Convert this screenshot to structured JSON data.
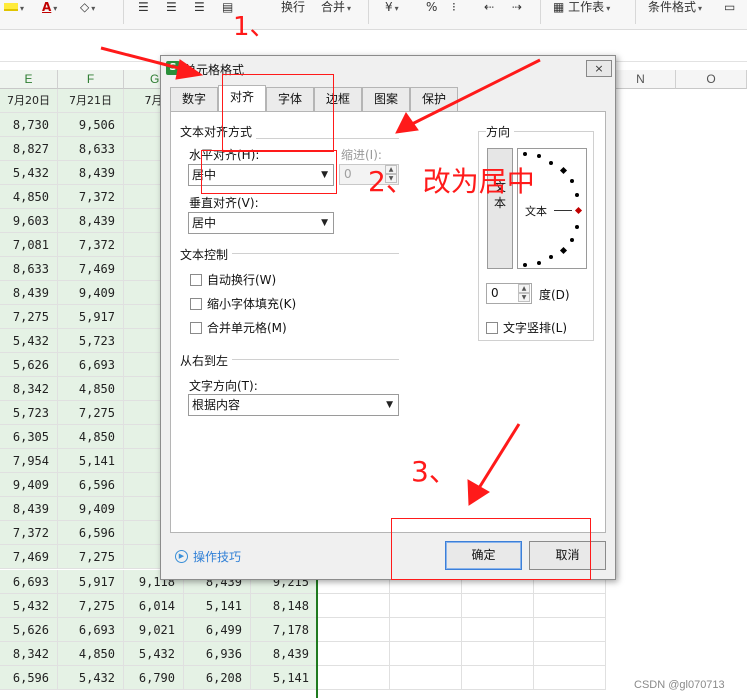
{
  "ribbon": {
    "items": [
      "换行",
      "合并",
      "%",
      "工作表",
      "条件格式"
    ]
  },
  "sheet": {
    "columns": [
      "E",
      "F",
      "G",
      "N",
      "O"
    ],
    "header_row": [
      "7月20日",
      "7月21日",
      "7月"
    ],
    "rows": [
      [
        "8,730",
        "9,506",
        "8,"
      ],
      [
        "8,827",
        "8,633",
        "5,"
      ],
      [
        "5,432",
        "8,439",
        "6,"
      ],
      [
        "4,850",
        "7,372",
        "6,"
      ],
      [
        "9,603",
        "8,439",
        "9,"
      ],
      [
        "7,081",
        "7,372",
        "6,"
      ],
      [
        "8,633",
        "7,469",
        "7,"
      ],
      [
        "8,439",
        "9,409",
        "6,"
      ],
      [
        "7,275",
        "5,917",
        "9,"
      ],
      [
        "5,432",
        "5,723",
        "6,"
      ],
      [
        "5,626",
        "6,693",
        "9,"
      ],
      [
        "8,342",
        "4,850",
        "8,"
      ],
      [
        "5,723",
        "7,275",
        "8,"
      ],
      [
        "6,305",
        "4,850",
        "7,"
      ],
      [
        "7,954",
        "5,141",
        "5,"
      ],
      [
        "9,409",
        "6,596",
        "6,"
      ],
      [
        "8,439",
        "9,409",
        "6,"
      ],
      [
        "7,372",
        "6,596",
        "5,"
      ],
      [
        "7,469",
        "7,275",
        "8,"
      ]
    ],
    "bottom_rows": [
      [
        "6,693",
        "5,917",
        "9,118",
        "8,439",
        "9,215"
      ],
      [
        "5,432",
        "7,275",
        "6,014",
        "5,141",
        "8,148"
      ],
      [
        "5,626",
        "6,693",
        "9,021",
        "6,499",
        "7,178"
      ],
      [
        "8,342",
        "4,850",
        "5,432",
        "6,936",
        "8,439"
      ],
      [
        "6,596",
        "5,432",
        "6,790",
        "6,208",
        "5,141"
      ]
    ]
  },
  "dialog": {
    "title": "单元格格式",
    "close_label": "×",
    "tabs": [
      "数字",
      "对齐",
      "字体",
      "边框",
      "图案",
      "保护"
    ],
    "active_tab": "对齐",
    "text_alignment": {
      "group_label": "文本对齐方式",
      "horizontal_label": "水平对齐(H):",
      "horizontal_value": "居中",
      "indent_label": "缩进(I):",
      "indent_value": "0",
      "vertical_label": "垂直对齐(V):",
      "vertical_value": "居中"
    },
    "text_control": {
      "group_label": "文本控制",
      "wrap_label": "自动换行(W)",
      "shrink_label": "缩小字体填充(K)",
      "merge_label": "合并单元格(M)"
    },
    "rtl": {
      "group_label": "从右到左",
      "direction_label": "文字方向(T):",
      "direction_value": "根据内容"
    },
    "orientation": {
      "group_label": "方向",
      "vertical_text": "文本",
      "dial_text": "文本",
      "degree_value": "0",
      "degree_label": "度(D)",
      "vertical_text_checkbox_label": "文字竖排(L)"
    },
    "tips_label": "操作技巧",
    "ok_label": "确定",
    "cancel_label": "取消"
  },
  "annotations": {
    "step1": "1、",
    "step2": "2、 改为居中",
    "step3": "3、",
    "color": "#ff1a1a"
  },
  "watermark": "CSDN @gl070713"
}
